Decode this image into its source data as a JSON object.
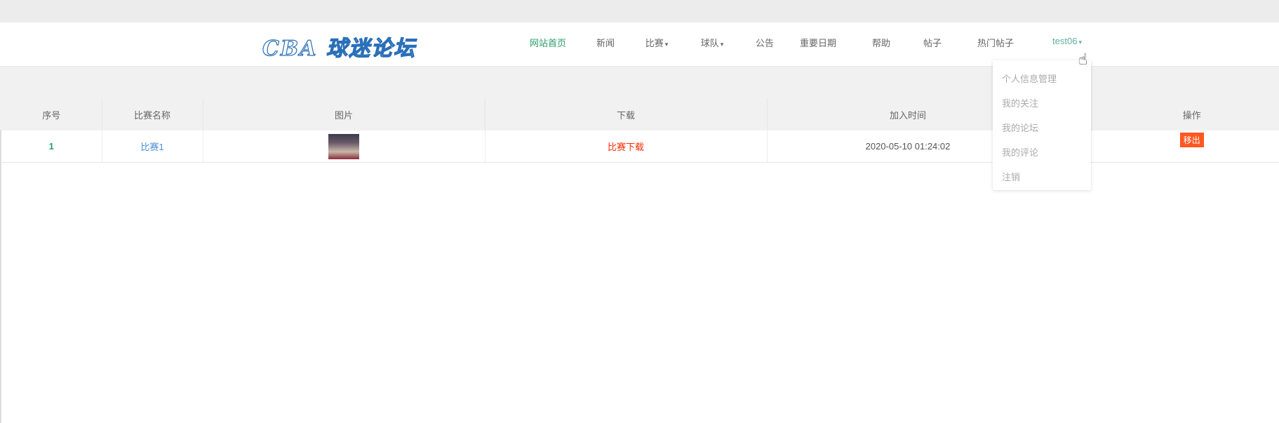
{
  "header": {
    "logo": "CBA 球迷论坛",
    "nav": [
      {
        "label": "网站首页"
      },
      {
        "label": "新闻"
      },
      {
        "label": "比赛",
        "caret": "▾"
      },
      {
        "label": "球队",
        "caret": "▾"
      },
      {
        "label": "公告"
      },
      {
        "label": "重要日期"
      },
      {
        "label": "帮助"
      },
      {
        "label": "帖子"
      },
      {
        "label": "热门帖子"
      }
    ],
    "user": {
      "label": "test06",
      "caret": "▾"
    }
  },
  "dropdown": {
    "items": [
      "个人信息管理",
      "我的关注",
      "我的论坛",
      "我的评论",
      "注销"
    ]
  },
  "table": {
    "headers": [
      "序号",
      "比赛名称",
      "图片",
      "下载",
      "加入时间",
      "操作"
    ],
    "rows": [
      {
        "index": "1",
        "name": "比赛1",
        "download": "比赛下载",
        "time": "2020-05-10 01:24:02",
        "action": "移出"
      }
    ]
  },
  "colors": {
    "active": "#2a9d6b",
    "link": "#4a90d9",
    "download": "#ff2a00",
    "remove": "#ff5722"
  }
}
